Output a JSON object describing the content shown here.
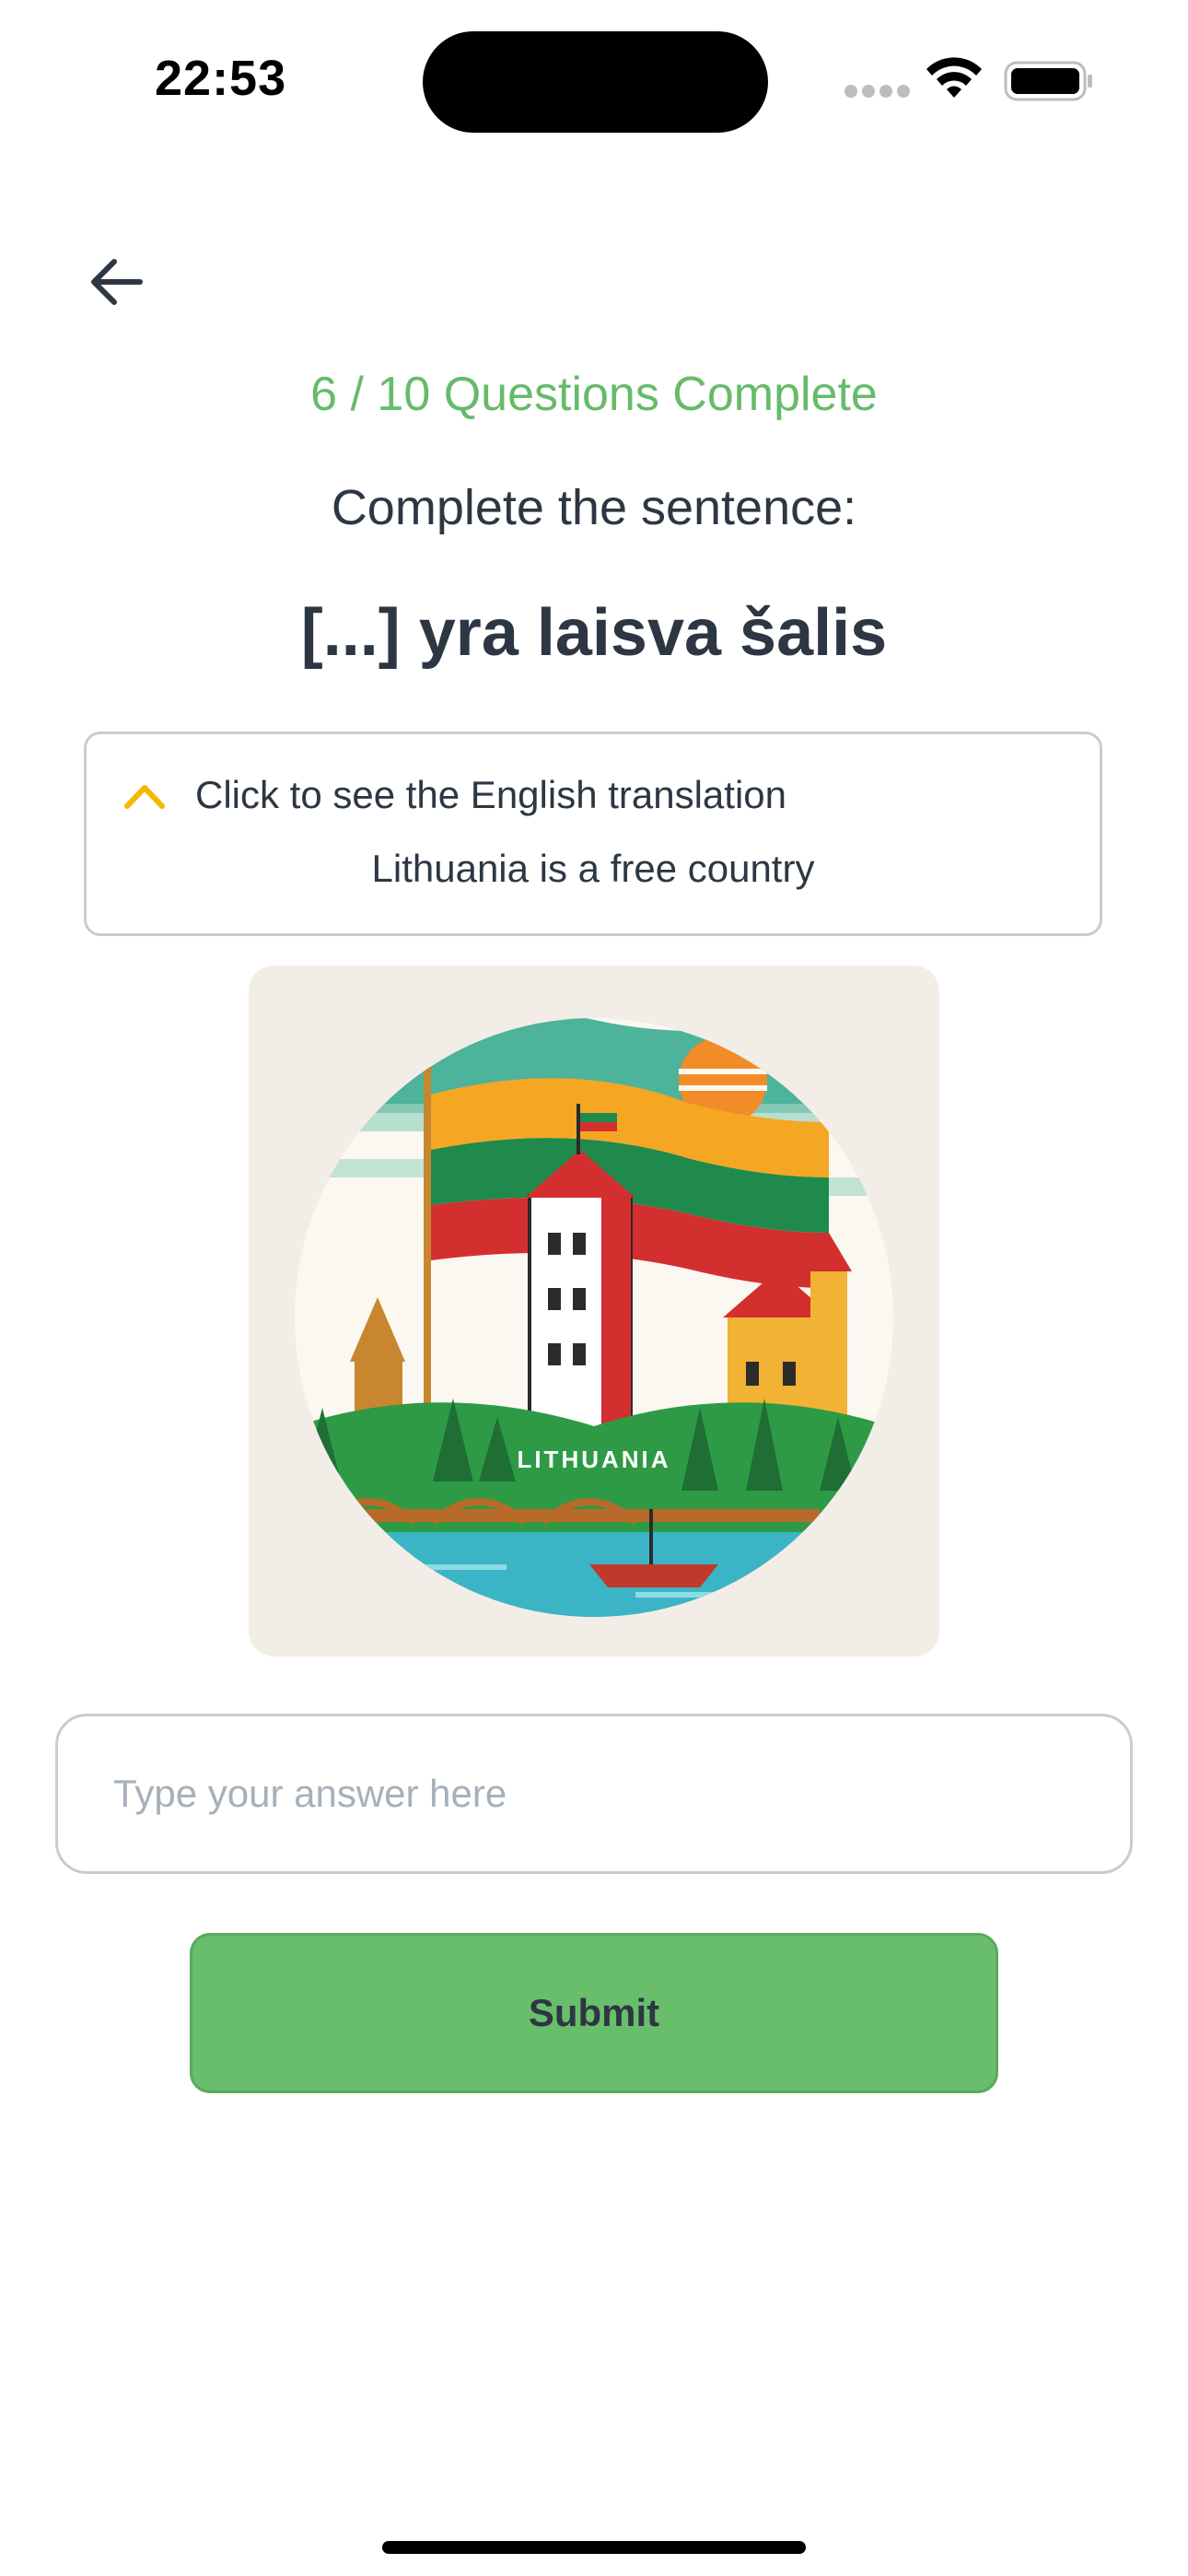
{
  "status_bar": {
    "time": "22:53"
  },
  "header": {
    "back_icon": "arrow-left-icon",
    "progress": "6 / 10 Questions Complete",
    "progress_color": "#66bb6a"
  },
  "question": {
    "instruction": "Complete the sentence:",
    "sentence": "[...] yra laisva šalis"
  },
  "translation": {
    "toggle_icon": "chevron-up-icon",
    "toggle_icon_color": "#f5b800",
    "toggle_label": "Click to see the English translation",
    "text": "Lithuania is a free country"
  },
  "illustration": {
    "label": "LITHUANIA"
  },
  "answer": {
    "placeholder": "Type your answer here",
    "value": ""
  },
  "submit": {
    "label": "Submit",
    "color": "#69be6b"
  }
}
